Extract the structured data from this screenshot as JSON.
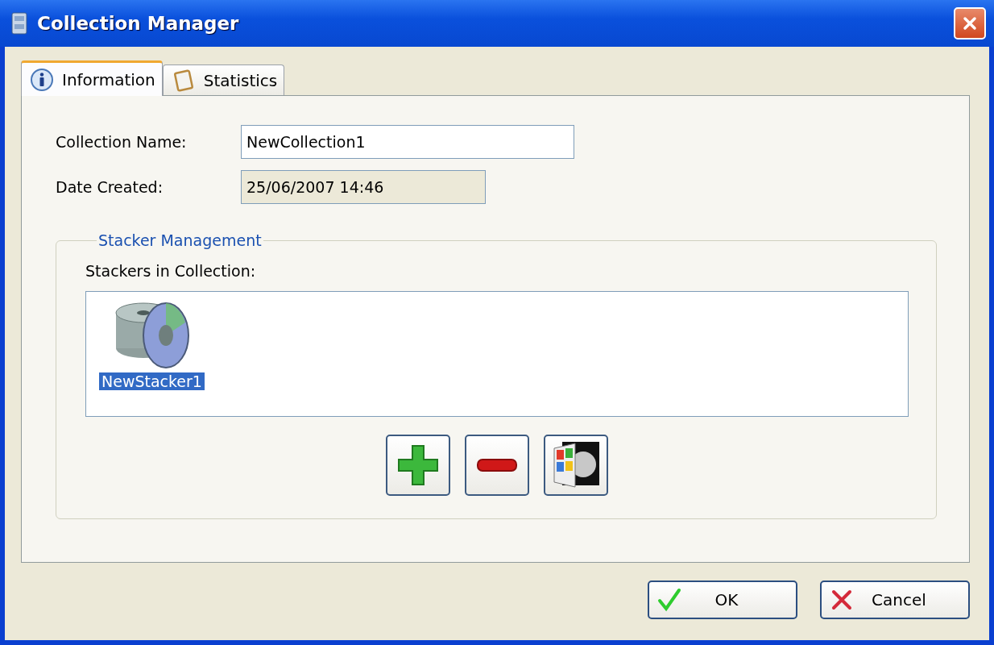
{
  "window": {
    "title": "Collection Manager"
  },
  "tabs": [
    {
      "label": "Information",
      "kind": "info",
      "selected": true
    },
    {
      "label": "Statistics",
      "kind": "clipboard",
      "selected": false
    }
  ],
  "fields": [
    {
      "label": "Collection Name:",
      "value": "NewCollection1",
      "disabled": false
    },
    {
      "label": "Date Created:",
      "value": "25/06/2007 14:46",
      "disabled": true
    }
  ],
  "group": {
    "title": "Stacker Management",
    "list_label": "Stackers in Collection:",
    "items": [
      {
        "label": "NewStacker1",
        "selected": true
      }
    ]
  },
  "buttons": [
    {
      "label": "OK",
      "kind": "ok"
    },
    {
      "label": "Cancel",
      "kind": "cancel"
    }
  ]
}
